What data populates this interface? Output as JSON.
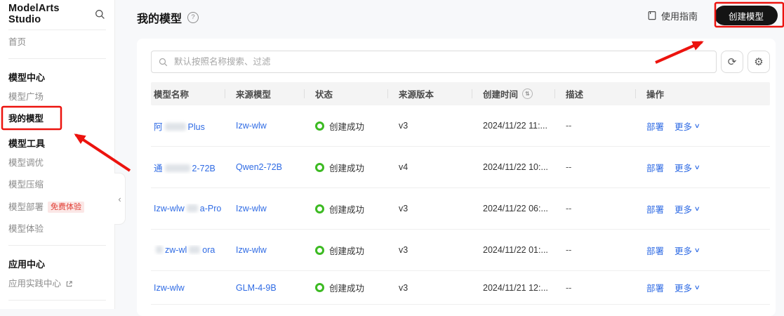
{
  "sidebar": {
    "brand": "ModelArts Studio",
    "items": [
      {
        "id": "home",
        "type": "link",
        "label": "首页"
      },
      {
        "id": "divider-1",
        "type": "divider"
      },
      {
        "id": "model-center",
        "type": "group",
        "label": "模型中心"
      },
      {
        "id": "model-square",
        "type": "link",
        "label": "模型广场"
      },
      {
        "id": "my-models",
        "type": "link",
        "label": "我的模型",
        "active": true
      },
      {
        "id": "model-tools",
        "type": "group",
        "label": "模型工具"
      },
      {
        "id": "model-tuning",
        "type": "link",
        "label": "模型调优"
      },
      {
        "id": "model-compression",
        "type": "link",
        "label": "模型压缩"
      },
      {
        "id": "model-deployment",
        "type": "link",
        "label": "模型部署",
        "badge": "免费体验"
      },
      {
        "id": "model-experience",
        "type": "link",
        "label": "模型体验"
      },
      {
        "id": "divider-2",
        "type": "divider"
      },
      {
        "id": "app-center",
        "type": "group",
        "label": "应用中心"
      },
      {
        "id": "app-practice-center",
        "type": "link",
        "label": "应用实践中心",
        "external": true
      },
      {
        "id": "divider-3",
        "type": "divider"
      }
    ]
  },
  "header": {
    "title": "我的模型",
    "guide_label": "使用指南",
    "create_button_label": "创建模型"
  },
  "toolbar": {
    "search_placeholder": "默认按照名称搜索、过滤"
  },
  "icons": {
    "help": "?",
    "refresh": "⟳",
    "gear": "⚙",
    "sort": "⇅",
    "caret_down": "∨",
    "collapse": "‹"
  },
  "table": {
    "columns": [
      {
        "label": "模型名称"
      },
      {
        "label": "来源模型"
      },
      {
        "label": "状态"
      },
      {
        "label": "来源版本"
      },
      {
        "label": "创建时间",
        "sort": true
      },
      {
        "label": "描述"
      },
      {
        "label": "操作"
      }
    ],
    "rows": [
      {
        "name_parts": [
          {
            "t": "阿"
          },
          {
            "b": 30
          },
          {
            "t": "Plus"
          }
        ],
        "sub_blur": true,
        "source": "Izw-wlw",
        "status": "创建成功",
        "version": "v3",
        "created": "2024/11/22 11:...",
        "description": "--",
        "actions": [
          "部署",
          "更多"
        ]
      },
      {
        "name_parts": [
          {
            "t": "通"
          },
          {
            "b": 36
          },
          {
            "t": "2-72B"
          }
        ],
        "sub_blur": true,
        "source": "Qwen2-72B",
        "status": "创建成功",
        "version": "v4",
        "created": "2024/11/22 10:...",
        "description": "--",
        "actions": [
          "部署",
          "更多"
        ]
      },
      {
        "name_parts": [
          {
            "t": "Izw-wlw"
          },
          {
            "b": 16
          },
          {
            "t": "a-Pro"
          }
        ],
        "sub_blur": true,
        "source": "Izw-wlw",
        "status": "创建成功",
        "version": "v3",
        "created": "2024/11/22 06:...",
        "description": "--",
        "actions": [
          "部署",
          "更多"
        ]
      },
      {
        "name_parts": [
          {
            "b": 10
          },
          {
            "t": "zw-wl"
          },
          {
            "b": 16
          },
          {
            "t": "ora"
          }
        ],
        "sub_blur": true,
        "source": "Izw-wlw",
        "status": "创建成功",
        "version": "v3",
        "created": "2024/11/22 01:...",
        "description": "--",
        "actions": [
          "部署",
          "更多"
        ]
      },
      {
        "name_parts": [
          {
            "t": "Izw-wlw"
          }
        ],
        "sub_blur": false,
        "source": "GLM-4-9B",
        "status": "创建成功",
        "version": "v3",
        "created": "2024/11/21 12:...",
        "description": "--",
        "actions": [
          "部署",
          "更多"
        ]
      }
    ]
  },
  "colors": {
    "link_blue": "#2f6be4",
    "status_green": "#3cba22",
    "annotation_red": "#ec130e",
    "button_black": "#141414"
  }
}
